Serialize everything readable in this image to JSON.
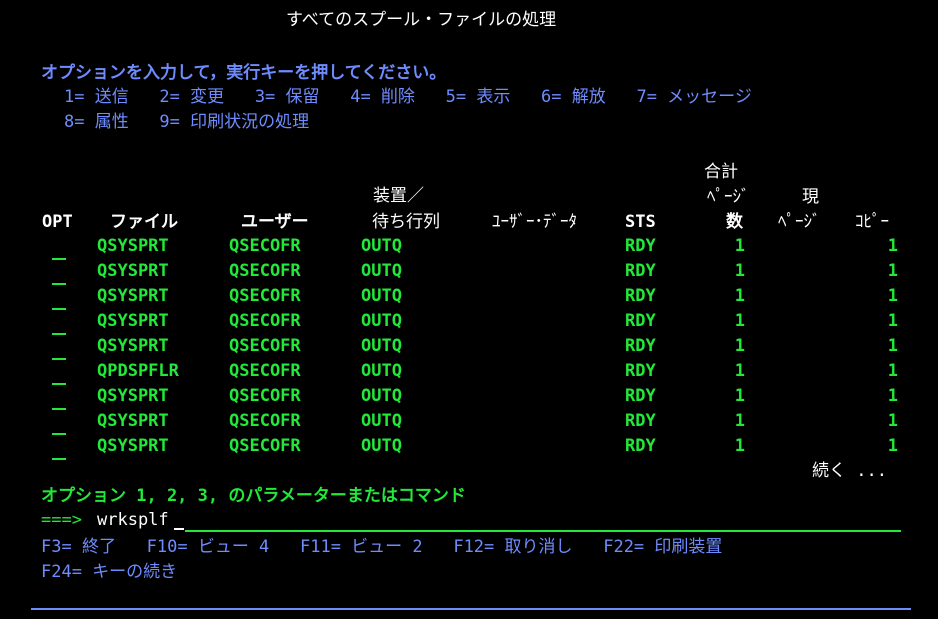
{
  "screen": {
    "title": "すべてのスプール・ファイルの処理",
    "instruction": "オプションを入力して，実行キーを押してください。",
    "options_line1": "1= 送信   2= 変更   3= 保留   4= 削除   5= 表示   6= 解放   7= メッセージ",
    "options_line2": "8= 属性   9= 印刷状況の処理"
  },
  "columns": {
    "total_line1": "合計",
    "total_line2": "ﾍﾟｰｼﾞ",
    "total_line3": "数",
    "current_line2": "現",
    "current_line3": "ﾍﾟｰｼﾞ",
    "device_line1": "装置／",
    "device_line2": "待ち行列",
    "opt": "OPT",
    "file": "ファイル",
    "user": "ユーザー",
    "userdata": "ﾕｰｻﾞｰ･ﾃﾞｰﾀ",
    "sts": "STS",
    "copies": "ｺﾋﾟｰ"
  },
  "rows": [
    {
      "file": "QSYSPRT",
      "user": "QSECOFR",
      "queue": "OUTQ",
      "sts": "RDY",
      "pages": "1",
      "copies": "1"
    },
    {
      "file": "QSYSPRT",
      "user": "QSECOFR",
      "queue": "OUTQ",
      "sts": "RDY",
      "pages": "1",
      "copies": "1"
    },
    {
      "file": "QSYSPRT",
      "user": "QSECOFR",
      "queue": "OUTQ",
      "sts": "RDY",
      "pages": "1",
      "copies": "1"
    },
    {
      "file": "QSYSPRT",
      "user": "QSECOFR",
      "queue": "OUTQ",
      "sts": "RDY",
      "pages": "1",
      "copies": "1"
    },
    {
      "file": "QSYSPRT",
      "user": "QSECOFR",
      "queue": "OUTQ",
      "sts": "RDY",
      "pages": "1",
      "copies": "1"
    },
    {
      "file": "QPDSPFLR",
      "user": "QSECOFR",
      "queue": "OUTQ",
      "sts": "RDY",
      "pages": "1",
      "copies": "1"
    },
    {
      "file": "QSYSPRT",
      "user": "QSECOFR",
      "queue": "OUTQ",
      "sts": "RDY",
      "pages": "1",
      "copies": "1"
    },
    {
      "file": "QSYSPRT",
      "user": "QSECOFR",
      "queue": "OUTQ",
      "sts": "RDY",
      "pages": "1",
      "copies": "1"
    },
    {
      "file": "QSYSPRT",
      "user": "QSECOFR",
      "queue": "OUTQ",
      "sts": "RDY",
      "pages": "1",
      "copies": "1"
    }
  ],
  "more": "続く ...",
  "command": {
    "label": "オプション 1, 2, 3, のパラメーターまたはコマンド",
    "prompt": "===>",
    "value": "wrksplf"
  },
  "fkeys": {
    "line1": "F3= 終了   F10= ビュー 4   F11= ビュー 2   F12= 取り消し   F22= 印刷装置",
    "line2": "F24= キーの続き"
  },
  "colors": {
    "background": "#000000",
    "green": "#22e83a",
    "blue": "#6f8cff",
    "white": "#ffffff"
  }
}
